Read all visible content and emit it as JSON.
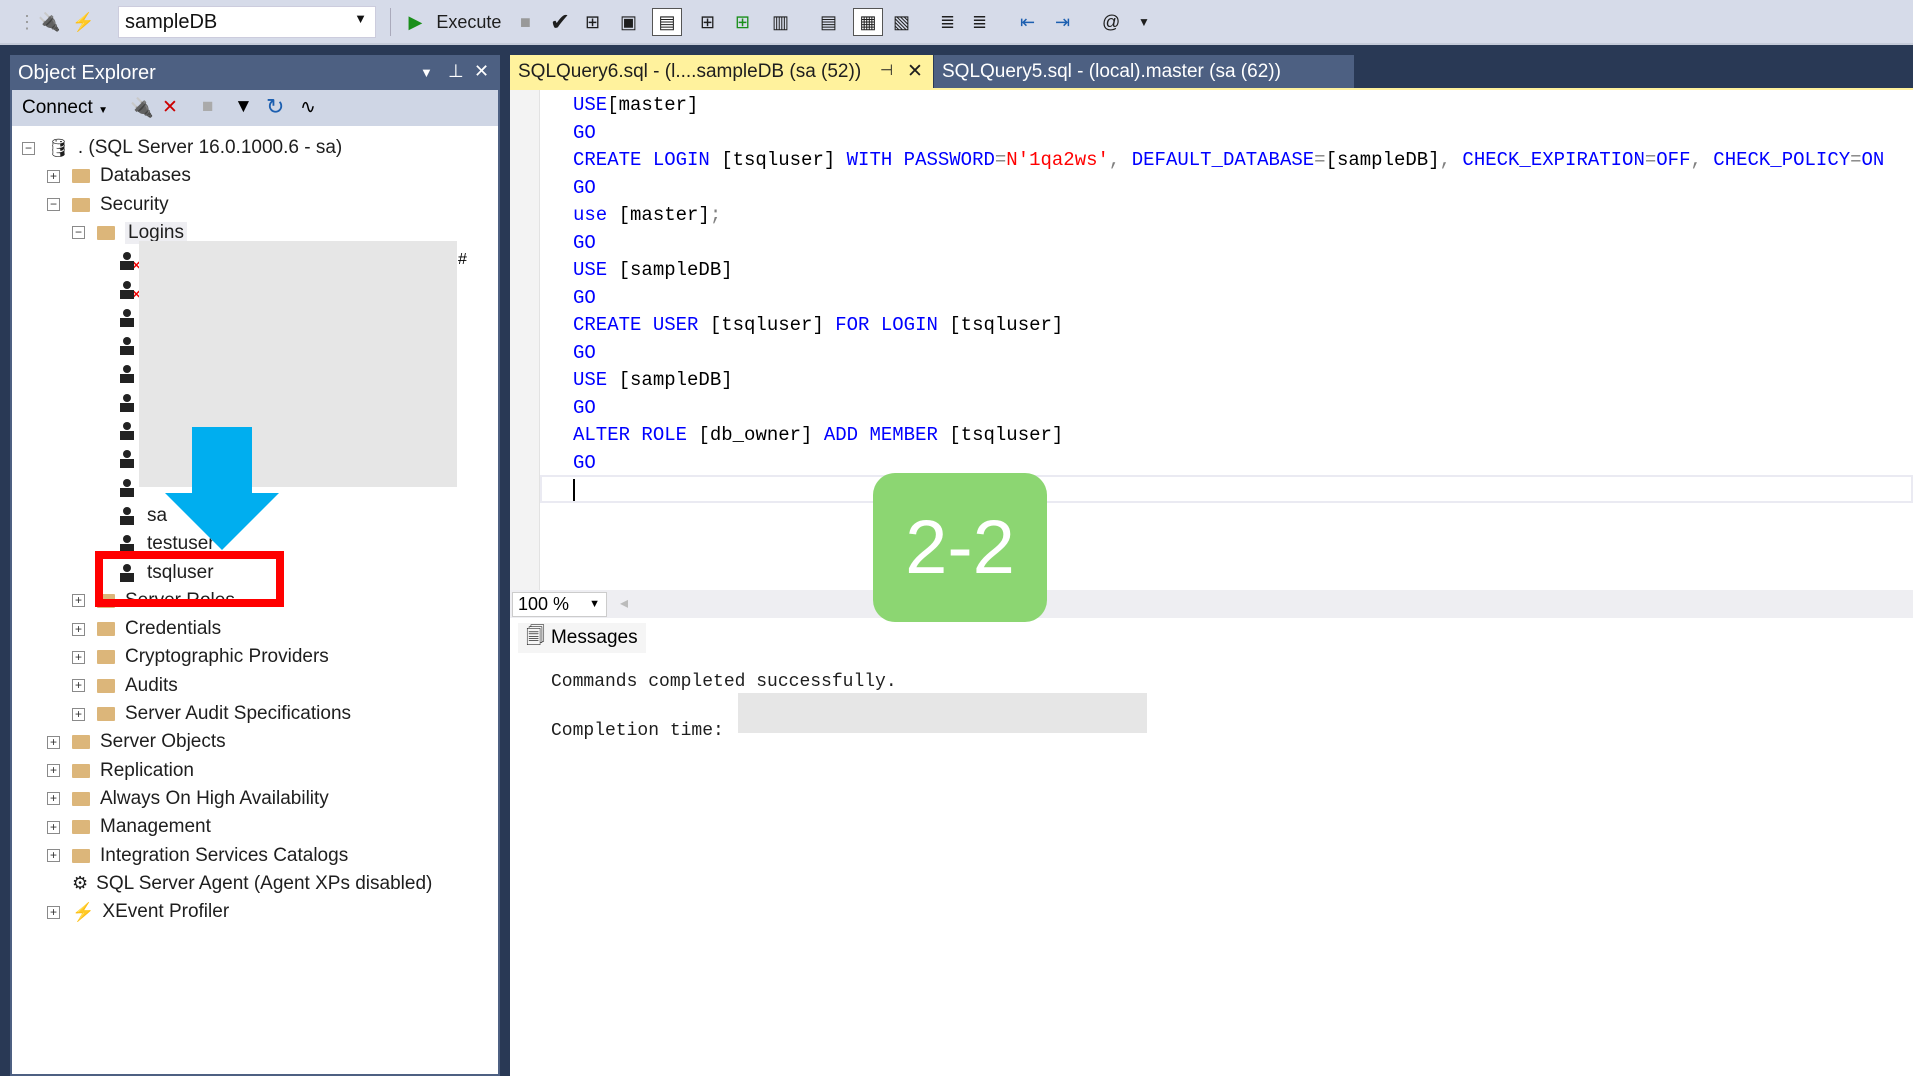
{
  "toolbar": {
    "database": "sampleDB",
    "execute_label": "Execute"
  },
  "object_explorer": {
    "title": "Object Explorer",
    "connect_label": "Connect",
    "tree": [
      {
        "level": 0,
        "toggle": "−",
        "icon": "server",
        "label": ". (SQL Server 16.0.1000.6 - sa)"
      },
      {
        "level": 1,
        "toggle": "+",
        "icon": "folder",
        "label": "Databases"
      },
      {
        "level": 1,
        "toggle": "−",
        "icon": "folder",
        "label": "Security"
      },
      {
        "level": 2,
        "toggle": "−",
        "icon": "folder",
        "label": "Logins",
        "selected": true
      },
      {
        "level": 3,
        "icon": "user-disabled",
        "label": ""
      },
      {
        "level": 3,
        "icon": "user-disabled",
        "label": ""
      },
      {
        "level": 3,
        "icon": "user",
        "label": ""
      },
      {
        "level": 3,
        "icon": "user",
        "label": ""
      },
      {
        "level": 3,
        "icon": "user",
        "label": ""
      },
      {
        "level": 3,
        "icon": "user",
        "label": ""
      },
      {
        "level": 3,
        "icon": "user",
        "label": ""
      },
      {
        "level": 3,
        "icon": "user",
        "label": ""
      },
      {
        "level": 3,
        "icon": "user",
        "label": ""
      },
      {
        "level": 3,
        "icon": "user",
        "label": "sa"
      },
      {
        "level": 3,
        "icon": "user",
        "label": "testuser"
      },
      {
        "level": 3,
        "icon": "user",
        "label": "tsqluser",
        "highlighted": true
      },
      {
        "level": 2,
        "toggle": "+",
        "icon": "folder",
        "label": "Server Roles"
      },
      {
        "level": 2,
        "toggle": "+",
        "icon": "folder",
        "label": "Credentials"
      },
      {
        "level": 2,
        "toggle": "+",
        "icon": "folder",
        "label": "Cryptographic Providers"
      },
      {
        "level": 2,
        "toggle": "+",
        "icon": "folder",
        "label": "Audits"
      },
      {
        "level": 2,
        "toggle": "+",
        "icon": "folder",
        "label": "Server Audit Specifications"
      },
      {
        "level": 1,
        "toggle": "+",
        "icon": "folder",
        "label": "Server Objects"
      },
      {
        "level": 1,
        "toggle": "+",
        "icon": "folder",
        "label": "Replication"
      },
      {
        "level": 1,
        "toggle": "+",
        "icon": "folder",
        "label": "Always On High Availability"
      },
      {
        "level": 1,
        "toggle": "+",
        "icon": "folder",
        "label": "Management"
      },
      {
        "level": 1,
        "toggle": "+",
        "icon": "folder",
        "label": "Integration Services Catalogs"
      },
      {
        "level": 1,
        "icon": "agent",
        "label": "SQL Server Agent (Agent XPs disabled)"
      },
      {
        "level": 1,
        "toggle": "+",
        "icon": "xevent",
        "label": "XEvent Profiler"
      }
    ]
  },
  "tabs": [
    {
      "label": "SQLQuery6.sql - (l....sampleDB (sa (52))",
      "active": true
    },
    {
      "label": "SQLQuery5.sql - (local).master (sa (62))",
      "active": false
    }
  ],
  "editor": {
    "lines": [
      [
        [
          "kw",
          "USE"
        ],
        [
          "",
          "[master]"
        ]
      ],
      [
        [
          "kw",
          "GO"
        ]
      ],
      [
        [
          "kw",
          "CREATE LOGIN"
        ],
        [
          "",
          " [tsqluser] "
        ],
        [
          "kw",
          "WITH PASSWORD"
        ],
        [
          "op",
          "="
        ],
        [
          "str",
          "N'1qa2ws'"
        ],
        [
          "op",
          ","
        ],
        [
          "",
          " "
        ],
        [
          "kw",
          "DEFAULT_DATABASE"
        ],
        [
          "op",
          "="
        ],
        [
          "",
          "[sampleDB]"
        ],
        [
          "op",
          ","
        ],
        [
          "",
          " "
        ],
        [
          "kw",
          "CHECK_EXPIRATION"
        ],
        [
          "op",
          "="
        ],
        [
          "kw",
          "OFF"
        ],
        [
          "op",
          ","
        ],
        [
          "",
          " "
        ],
        [
          "kw",
          "CHECK_POLICY"
        ],
        [
          "op",
          "="
        ],
        [
          "kw",
          "ON"
        ]
      ],
      [
        [
          "kw",
          "GO"
        ]
      ],
      [
        [
          "kw",
          "use"
        ],
        [
          "",
          " [master]"
        ],
        [
          "op",
          ";"
        ]
      ],
      [
        [
          "kw",
          "GO"
        ]
      ],
      [
        [
          "kw",
          "USE"
        ],
        [
          "",
          " [sampleDB]"
        ]
      ],
      [
        [
          "kw",
          "GO"
        ]
      ],
      [
        [
          "kw",
          "CREATE USER"
        ],
        [
          "",
          " [tsqluser] "
        ],
        [
          "kw",
          "FOR LOGIN"
        ],
        [
          "",
          " [tsqluser]"
        ]
      ],
      [
        [
          "kw",
          "GO"
        ]
      ],
      [
        [
          "kw",
          "USE"
        ],
        [
          "",
          " [sampleDB]"
        ]
      ],
      [
        [
          "kw",
          "GO"
        ]
      ],
      [
        [
          "kw",
          "ALTER ROLE"
        ],
        [
          "",
          " [db_owner] "
        ],
        [
          "kw",
          "ADD MEMBER"
        ],
        [
          "",
          " [tsqluser]"
        ]
      ],
      [
        [
          "kw",
          "GO"
        ]
      ]
    ],
    "zoom": "100 %"
  },
  "results": {
    "tab_label": "Messages",
    "line1": "Commands completed successfully.",
    "line2": "Completion time:"
  },
  "annotation": {
    "badge": "2-2",
    "arrow_color": "#00aeef",
    "box_color": "#ff0000",
    "badge_color": "#8cd672"
  }
}
